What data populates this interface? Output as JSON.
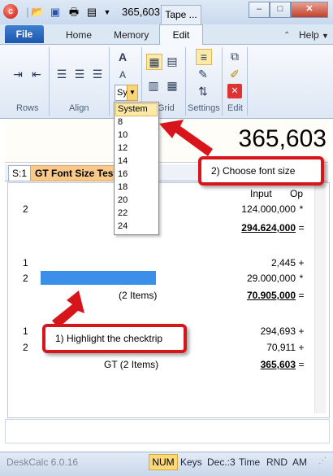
{
  "titlebar": {
    "value": "365,603",
    "tab_label": "Tape ...",
    "min_label": "–",
    "max_label": "□",
    "close_label": "✕"
  },
  "ribbon": {
    "tabs": {
      "file": "File",
      "home": "Home",
      "memory": "Memory",
      "edit": "Edit",
      "help": "Help"
    },
    "groups": {
      "rows": "Rows",
      "align": "Align",
      "grid": "Grid",
      "settings": "Settings",
      "edit": "Edit"
    },
    "font_size_value": "Sy"
  },
  "display": {
    "value": "365,603"
  },
  "sheet": {
    "index": "S:1",
    "name": "GT Font Size Test"
  },
  "tape": {
    "headers": {
      "input": "Input",
      "op": "Op"
    },
    "rows": [
      {
        "line": "2",
        "label": "",
        "input": "124.000,000",
        "op": "*",
        "bold": false
      },
      {
        "line": "",
        "label": "",
        "input": "294.624,000",
        "op": "=",
        "bold": true
      },
      {
        "line": "1",
        "label": "",
        "input": "2,445",
        "op": "+",
        "bold": false
      },
      {
        "line": "2",
        "label": "",
        "input": "29.000,000",
        "op": "*",
        "bold": false
      },
      {
        "line": "",
        "label": "(2 Items)",
        "input": "70.905,000",
        "op": "=",
        "bold": true
      },
      {
        "line": "1",
        "label": "",
        "input": "294,693",
        "op": "+",
        "bold": false
      },
      {
        "line": "2",
        "label": "",
        "input": "70,911",
        "op": "+",
        "bold": false
      },
      {
        "line": "",
        "label": "GT (2 Items)",
        "input": "365,603",
        "op": "=",
        "bold": true
      }
    ]
  },
  "status": {
    "app": "DeskCalc 6.0.16",
    "num": "NUM",
    "keys": "Keys",
    "dec": "Dec.:3",
    "time": "Time",
    "rnd": "RND",
    "am": "AM"
  },
  "font_dropdown": {
    "options": [
      "System",
      "8",
      "10",
      "12",
      "14",
      "16",
      "18",
      "20",
      "22",
      "24"
    ],
    "selected": "System"
  },
  "callouts": {
    "choose_font": "2) Choose font size",
    "highlight": "1) Highlight the checktrip"
  },
  "colors": {
    "accent": "#d8151b",
    "file_tab": "#1c57ad",
    "highlight": "#3b8fe8"
  }
}
